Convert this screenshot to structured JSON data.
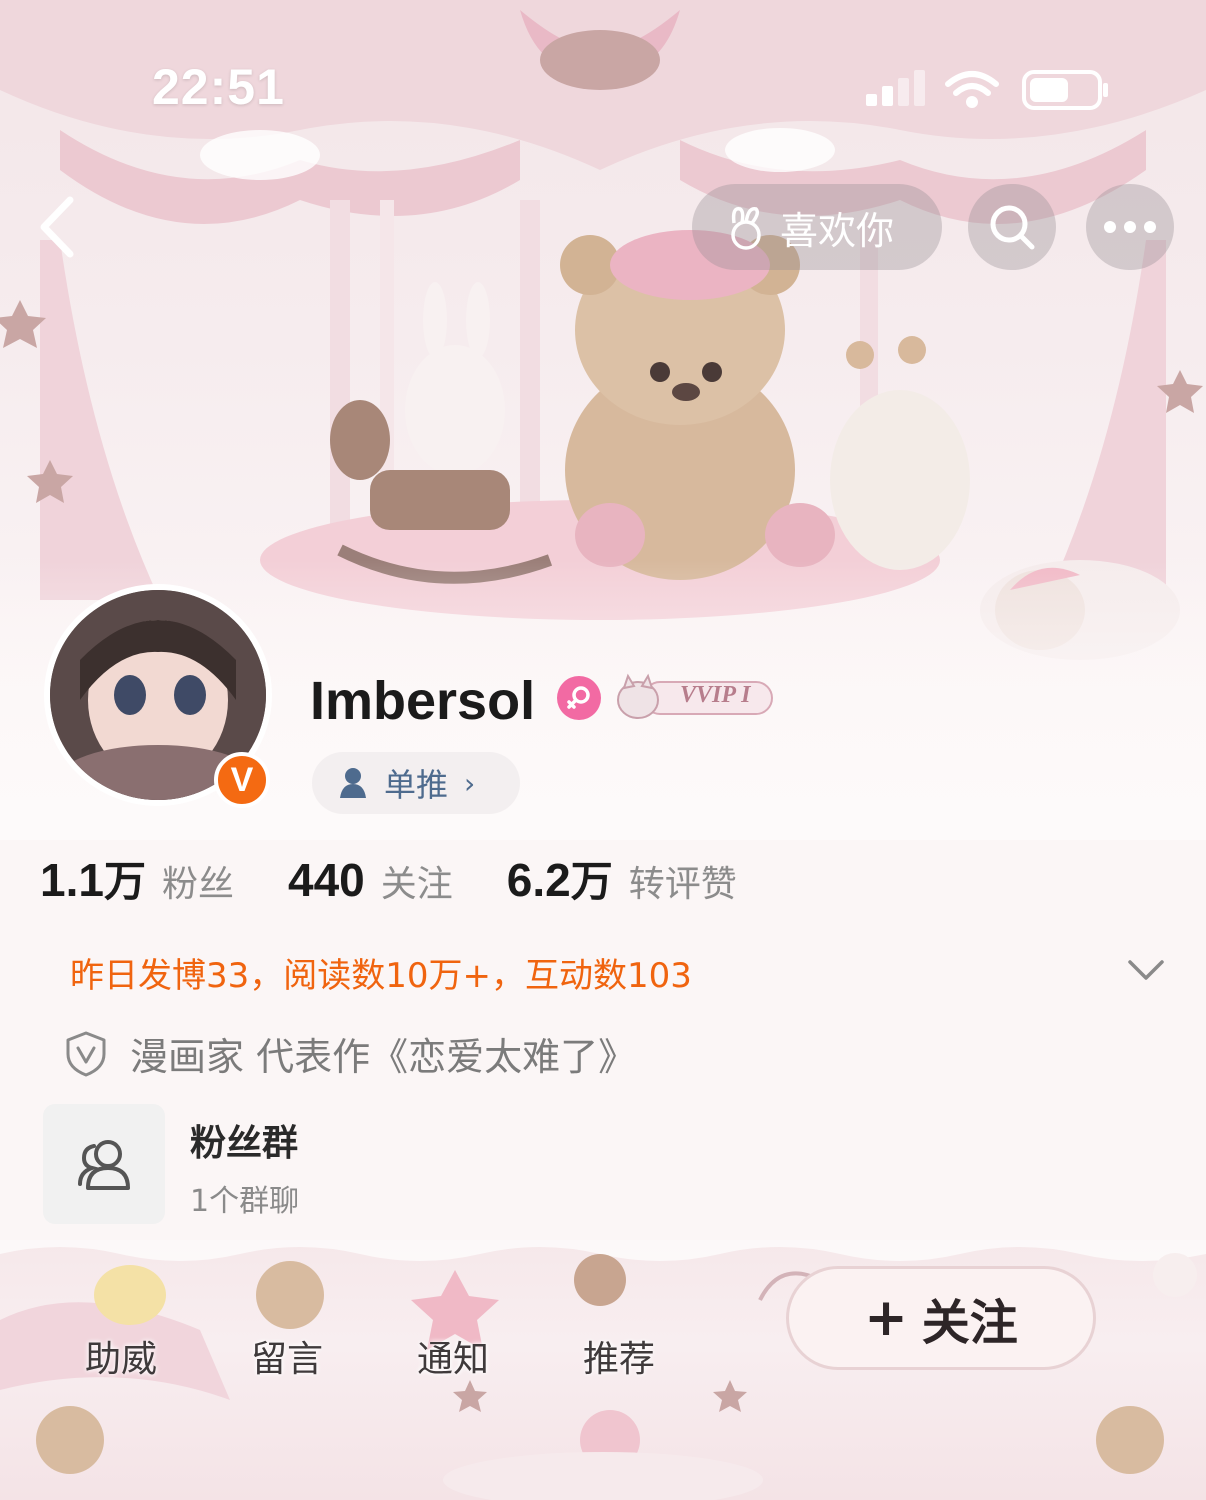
{
  "status_bar": {
    "time": "22:51"
  },
  "nav": {
    "like_label": "喜欢你"
  },
  "profile": {
    "username": "Imbersol",
    "verified_badge": "V",
    "vip_label": "VVIP I",
    "sole_label": "单推"
  },
  "stats": [
    {
      "value": "1.1",
      "unit": "万",
      "label": "粉丝"
    },
    {
      "value": "440",
      "unit": "",
      "label": "关注"
    },
    {
      "value": "6.2",
      "unit": "万",
      "label": "转评赞"
    }
  ],
  "activity": "昨日发博33，阅读数10万+，互动数103",
  "verification": "漫画家 代表作《恋爱太难了》",
  "fan_group": {
    "title": "粉丝群",
    "subtitle": "1个群聊"
  },
  "tabs": [
    {
      "label": "助威"
    },
    {
      "label": "留言"
    },
    {
      "label": "通知"
    },
    {
      "label": "推荐"
    }
  ],
  "follow_button": {
    "label": "关注"
  },
  "colors": {
    "accent_orange": "#f46a12",
    "activity_orange": "#f0640f",
    "link_blue": "#4e6b8e",
    "gender_pink": "#f26aa3"
  }
}
